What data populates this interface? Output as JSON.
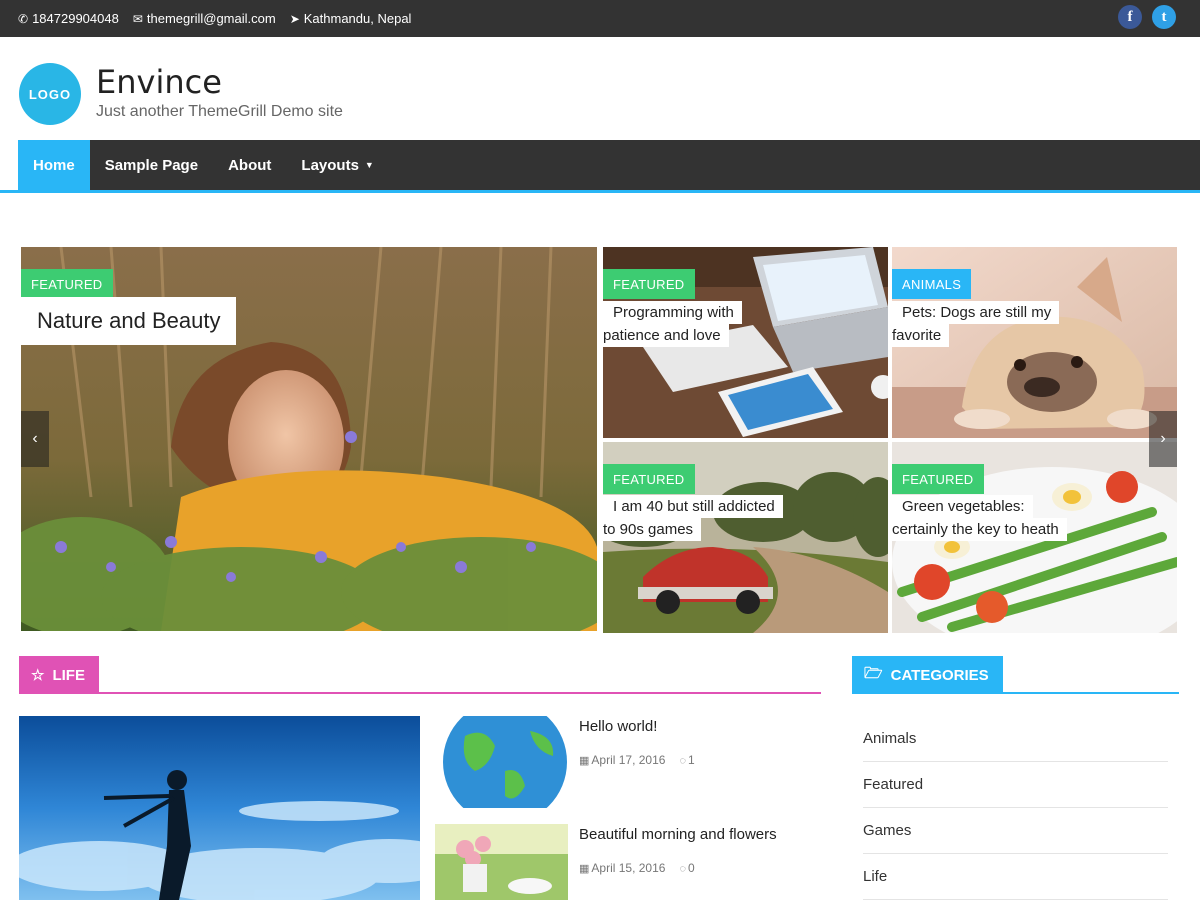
{
  "topbar": {
    "phone": "184729904048",
    "email": "themegrill@gmail.com",
    "location": "Kathmandu, Nepal",
    "phone_icon": "phone-icon",
    "email_icon": "envelope-icon",
    "location_icon": "location-arrow-icon",
    "social": [
      {
        "name": "facebook-icon",
        "glyph": "f",
        "color": "#3b5998"
      },
      {
        "name": "twitter-icon",
        "glyph": "t",
        "color": "#2fa0e6"
      }
    ]
  },
  "header": {
    "logo_text": "LOGO",
    "site_title": "Envince",
    "tagline": "Just another ThemeGrill Demo site"
  },
  "nav": {
    "items": [
      {
        "label": "Home",
        "active": true
      },
      {
        "label": "Sample Page"
      },
      {
        "label": "About"
      },
      {
        "label": "Layouts",
        "has_dropdown": true
      }
    ],
    "accent": "#29b6f6"
  },
  "slider": {
    "main": {
      "badge": "FEATURED",
      "title": "Nature and Beauty"
    },
    "tiles": [
      {
        "badge": "FEATURED",
        "title_line1": "Programming with",
        "title_line2": "patience and love"
      },
      {
        "badge": "ANIMALS",
        "title_line1": "Pets: Dogs are still my",
        "title_line2": "favorite"
      },
      {
        "badge": "FEATURED",
        "title_line1": "I am 40 but still addicted",
        "title_line2": "to 90s games"
      },
      {
        "badge": "FEATURED",
        "title_line1": "Green vegetables:",
        "title_line2": "certainly the key to heath"
      }
    ],
    "prev_icon": "chevron-left-icon",
    "next_icon": "chevron-right-icon",
    "colors": {
      "featured": "#3dcc72",
      "animals": "#29b6f6"
    }
  },
  "life": {
    "label": "LIFE",
    "color": "#e052b5",
    "posts": [
      {
        "title": "Hello world!",
        "date": "April 17, 2016",
        "comments": "1"
      },
      {
        "title": "Beautiful morning and flowers",
        "date": "April 15, 2016",
        "comments": "0"
      }
    ]
  },
  "categories": {
    "label": "CATEGORIES",
    "color": "#29b6f6",
    "items": [
      "Animals",
      "Featured",
      "Games",
      "Life"
    ]
  }
}
